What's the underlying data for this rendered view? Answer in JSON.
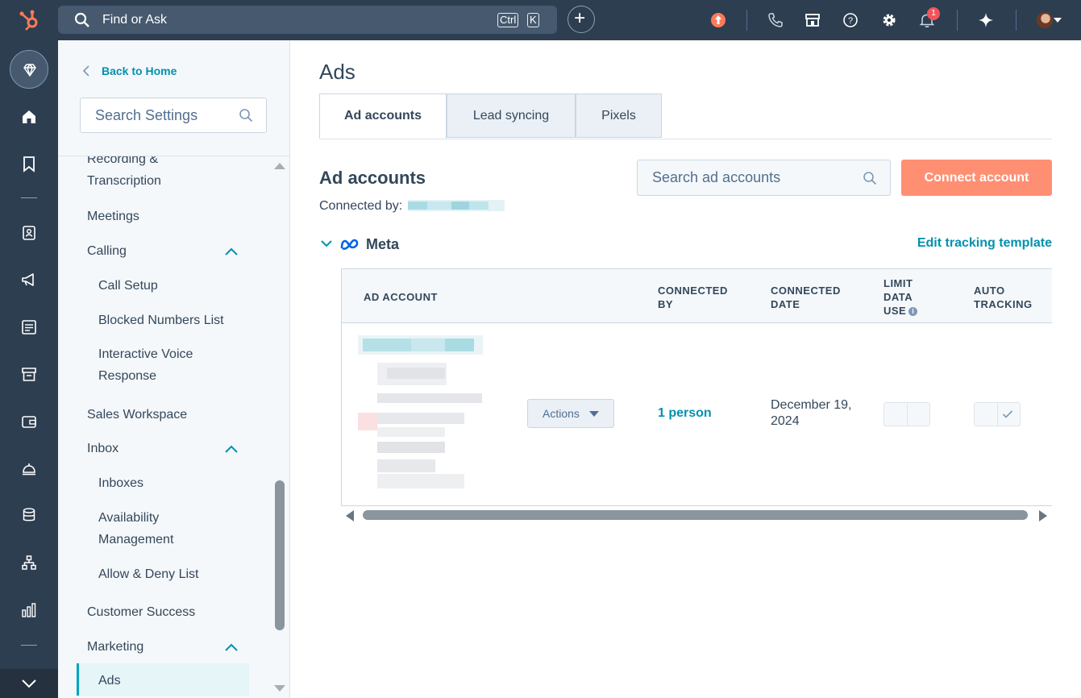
{
  "topbar": {
    "search_label": "Find or Ask",
    "shortcut_ctrl": "Ctrl",
    "shortcut_key": "K",
    "notification_count": "1",
    "colors": {
      "bar": "#2d3e50",
      "search": "#46596e",
      "brand": "#ff7a59"
    },
    "icons": [
      "hubspot-logo",
      "search-icon",
      "plus-icon",
      "upgrade-icon",
      "phone-icon",
      "marketplace-icon",
      "help-icon",
      "settings-gear-icon",
      "notification-bell-icon",
      "ai-sparkle-icon",
      "avatar"
    ]
  },
  "rail": {
    "icons": [
      "gem-icon",
      "home-icon",
      "bookmark-icon",
      "contacts-icon",
      "marketing-megaphone-icon",
      "content-icon",
      "commerce-icon",
      "wallet-icon",
      "service-bell-icon",
      "data-database-icon",
      "automation-icon",
      "reporting-chart-icon",
      "expand-chevron-icon"
    ]
  },
  "sidebar": {
    "back_label": "Back to Home",
    "search_placeholder": "Search Settings",
    "items": [
      {
        "label": "Recording & Transcription"
      },
      {
        "label": "Meetings"
      },
      {
        "label": "Calling"
      },
      {
        "label": "Call Setup"
      },
      {
        "label": "Blocked Numbers List"
      },
      {
        "label": "Interactive Voice Response"
      },
      {
        "label": "Sales Workspace"
      },
      {
        "label": "Inbox"
      },
      {
        "label": "Inboxes"
      },
      {
        "label": "Availability Management"
      },
      {
        "label": "Allow & Deny List"
      },
      {
        "label": "Customer Success"
      },
      {
        "label": "Marketing"
      },
      {
        "label": "Ads"
      }
    ],
    "active_item": "Ads"
  },
  "main": {
    "page_title": "Ads",
    "tabs": [
      {
        "label": "Ad accounts",
        "active": true
      },
      {
        "label": "Lead syncing",
        "active": false
      },
      {
        "label": "Pixels",
        "active": false
      }
    ],
    "section_title": "Ad accounts",
    "connected_by_label": "Connected by:",
    "search_placeholder": "Search ad accounts",
    "connect_button": "Connect account",
    "network_name": "Meta",
    "edit_template_link": "Edit tracking template",
    "table": {
      "headers": [
        "AD ACCOUNT",
        "CONNECTED BY",
        "CONNECTED DATE",
        "LIMIT DATA USE",
        "AUTO TRACKING"
      ],
      "rows": [
        {
          "actions_label": "Actions",
          "connected_by": "1 person",
          "connected_date": "December 19, 2024",
          "limit_data_use": false,
          "auto_tracking": true
        }
      ]
    },
    "colors": {
      "accent_link": "#0091ae",
      "connect_button": "#ff8f73",
      "text": "#33475b"
    }
  }
}
